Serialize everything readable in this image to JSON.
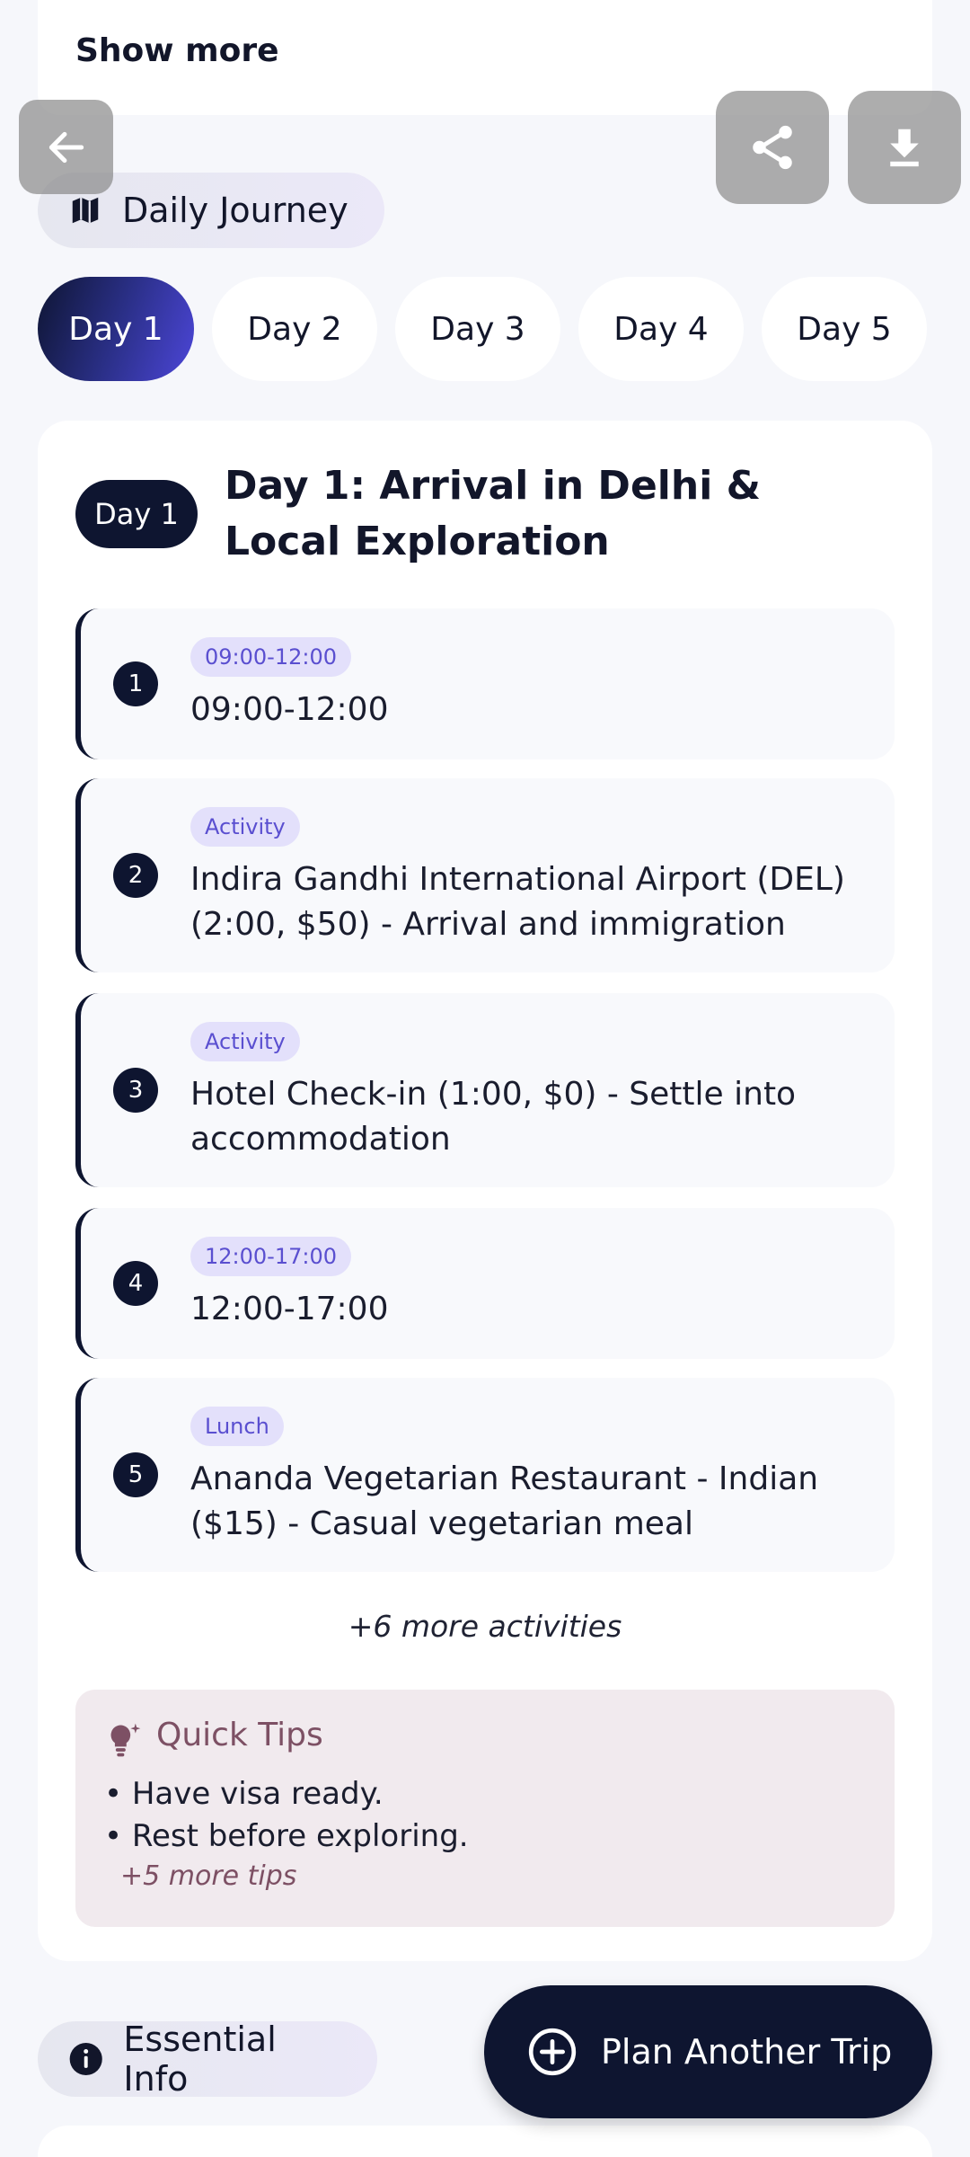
{
  "header": {
    "show_more_label": "Show more"
  },
  "toolbar": {
    "back_icon": "arrow-left-icon",
    "share_icon": "share-icon",
    "download_icon": "download-icon"
  },
  "journey_section": {
    "icon": "map-icon",
    "label": "Daily Journey"
  },
  "day_tabs": [
    {
      "label": "Day 1",
      "active": true
    },
    {
      "label": "Day 2",
      "active": false
    },
    {
      "label": "Day 3",
      "active": false
    },
    {
      "label": "Day 4",
      "active": false
    },
    {
      "label": "Day 5",
      "active": false
    }
  ],
  "day_card": {
    "badge": "Day 1",
    "title": "Day 1: Arrival in Delhi & Local Exploration",
    "activities": [
      {
        "number": "1",
        "tag": "09:00-12:00",
        "text": "09:00-12:00"
      },
      {
        "number": "2",
        "tag": "Activity",
        "text": "Indira Gandhi International Airport (DEL) (2:00, $50) - Arrival and immigration"
      },
      {
        "number": "3",
        "tag": "Activity",
        "text": "Hotel Check-in (1:00, $0) - Settle into accommodation"
      },
      {
        "number": "4",
        "tag": "12:00-17:00",
        "text": "12:00-17:00"
      },
      {
        "number": "5",
        "tag": "Lunch",
        "text": "Ananda Vegetarian Restaurant - Indian ($15) - Casual vegetarian meal"
      }
    ],
    "more_activities": "+6 more activities"
  },
  "quick_tips": {
    "icon": "lightbulb-icon",
    "title": "Quick Tips",
    "tips": [
      "• Have visa ready.",
      "• Rest before exploring."
    ],
    "more": "+5 more tips"
  },
  "essential_section": {
    "icon": "info-icon",
    "label": "Essential Info"
  },
  "plan_button": {
    "icon": "plus-circle-icon",
    "label": "Plan Another Trip"
  },
  "colors": {
    "navy": "#0e1530",
    "accent": "#4c46d8",
    "tag_bg": "#e3e0fb",
    "tips_bg": "#f1eaee",
    "tips_title": "#7d5064"
  }
}
